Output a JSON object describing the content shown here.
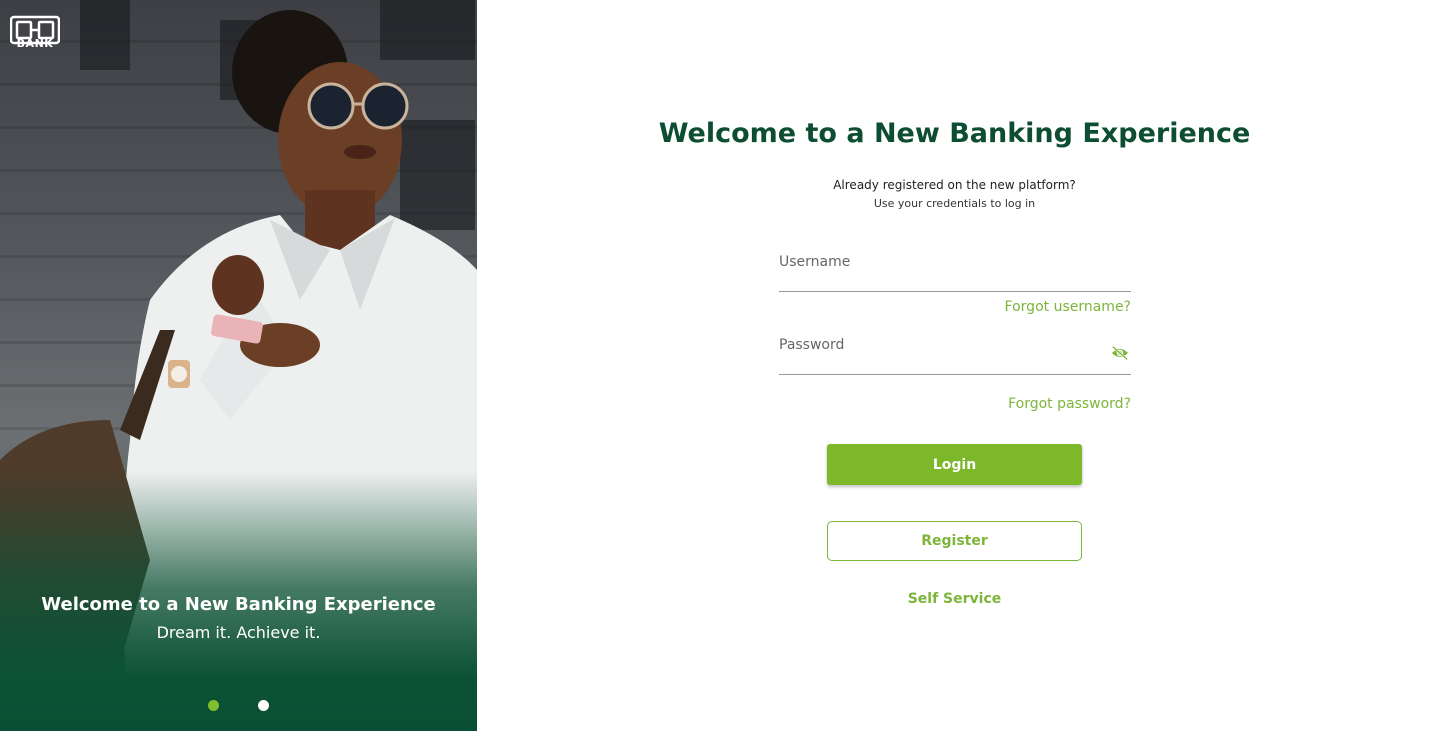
{
  "brand": {
    "logo_text": "BANK",
    "primary_color": "#0d4d32",
    "accent_color": "#7cb82a"
  },
  "hero": {
    "title": "Welcome to a New Banking Experience",
    "subtitle": "Dream it. Achieve it.",
    "carousel_active_index": 0,
    "carousel_count": 2
  },
  "login": {
    "title": "Welcome to a New Banking Experience",
    "question": "Already registered on the new platform?",
    "instruction": "Use your credentials to log in",
    "username_placeholder": "Username",
    "username_value": "",
    "password_placeholder": "Password",
    "password_value": "",
    "password_toggle_icon": "eye-off-icon",
    "forgot_username": "Forgot username?",
    "forgot_password": "Forgot password?",
    "login_label": "Login",
    "register_label": "Register",
    "self_service_label": "Self Service"
  }
}
